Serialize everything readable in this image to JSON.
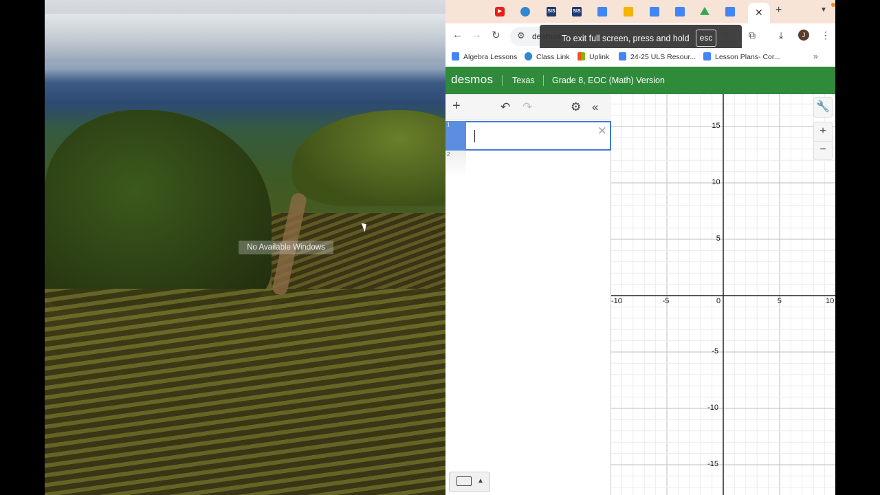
{
  "desktop": {
    "no_windows_label": "No Available Windows"
  },
  "browser": {
    "tabs": [
      {
        "icon": "youtube-icon",
        "color": "#e62117",
        "text": ""
      },
      {
        "icon": "classlink-icon",
        "color": "#2f88d1",
        "text": ""
      },
      {
        "icon": "sis-icon",
        "color": "#1e3a6e",
        "text": "SIS"
      },
      {
        "icon": "sis-icon",
        "color": "#1e3a6e",
        "text": "SIS"
      },
      {
        "icon": "docs-icon",
        "color": "#4285f4",
        "text": ""
      },
      {
        "icon": "slides-icon",
        "color": "#f4b400",
        "text": ""
      },
      {
        "icon": "docs-icon",
        "color": "#4285f4",
        "text": ""
      },
      {
        "icon": "docs-icon",
        "color": "#4285f4",
        "text": ""
      },
      {
        "icon": "drive-icon",
        "color": "#34a853",
        "text": ""
      },
      {
        "icon": "docs-icon",
        "color": "#4285f4",
        "text": ""
      }
    ],
    "url_partial": "desmos",
    "fullscreen_tooltip": {
      "text": "To exit full screen, press and hold",
      "key": "esc"
    },
    "avatar_letter": "J",
    "bookmarks": [
      {
        "label": "Algebra Lessons",
        "icon": "docs-icon",
        "color": "#4285f4"
      },
      {
        "label": "Class Link",
        "icon": "classlink-icon",
        "color": "#2f88d1"
      },
      {
        "label": "Uplink",
        "icon": "microsoft-icon",
        "color": "#f25022"
      },
      {
        "label": "24-25 ULS Resour...",
        "icon": "docs-icon",
        "color": "#4285f4"
      },
      {
        "label": "Lesson Plans- Cor...",
        "icon": "docs-icon",
        "color": "#4285f4"
      }
    ]
  },
  "desmos": {
    "logo": "desmos",
    "region": "Texas",
    "version": "Grade 8, EOC (Math) Version",
    "header_color": "#2f8a3a",
    "expressions": [
      {
        "index": "1",
        "value": ""
      },
      {
        "index": "2",
        "value": ""
      }
    ],
    "x_ticks": [
      "-10",
      "-5",
      "0",
      "5",
      "10"
    ],
    "y_ticks": [
      "15",
      "10",
      "5",
      "-5",
      "-10",
      "-15"
    ]
  }
}
